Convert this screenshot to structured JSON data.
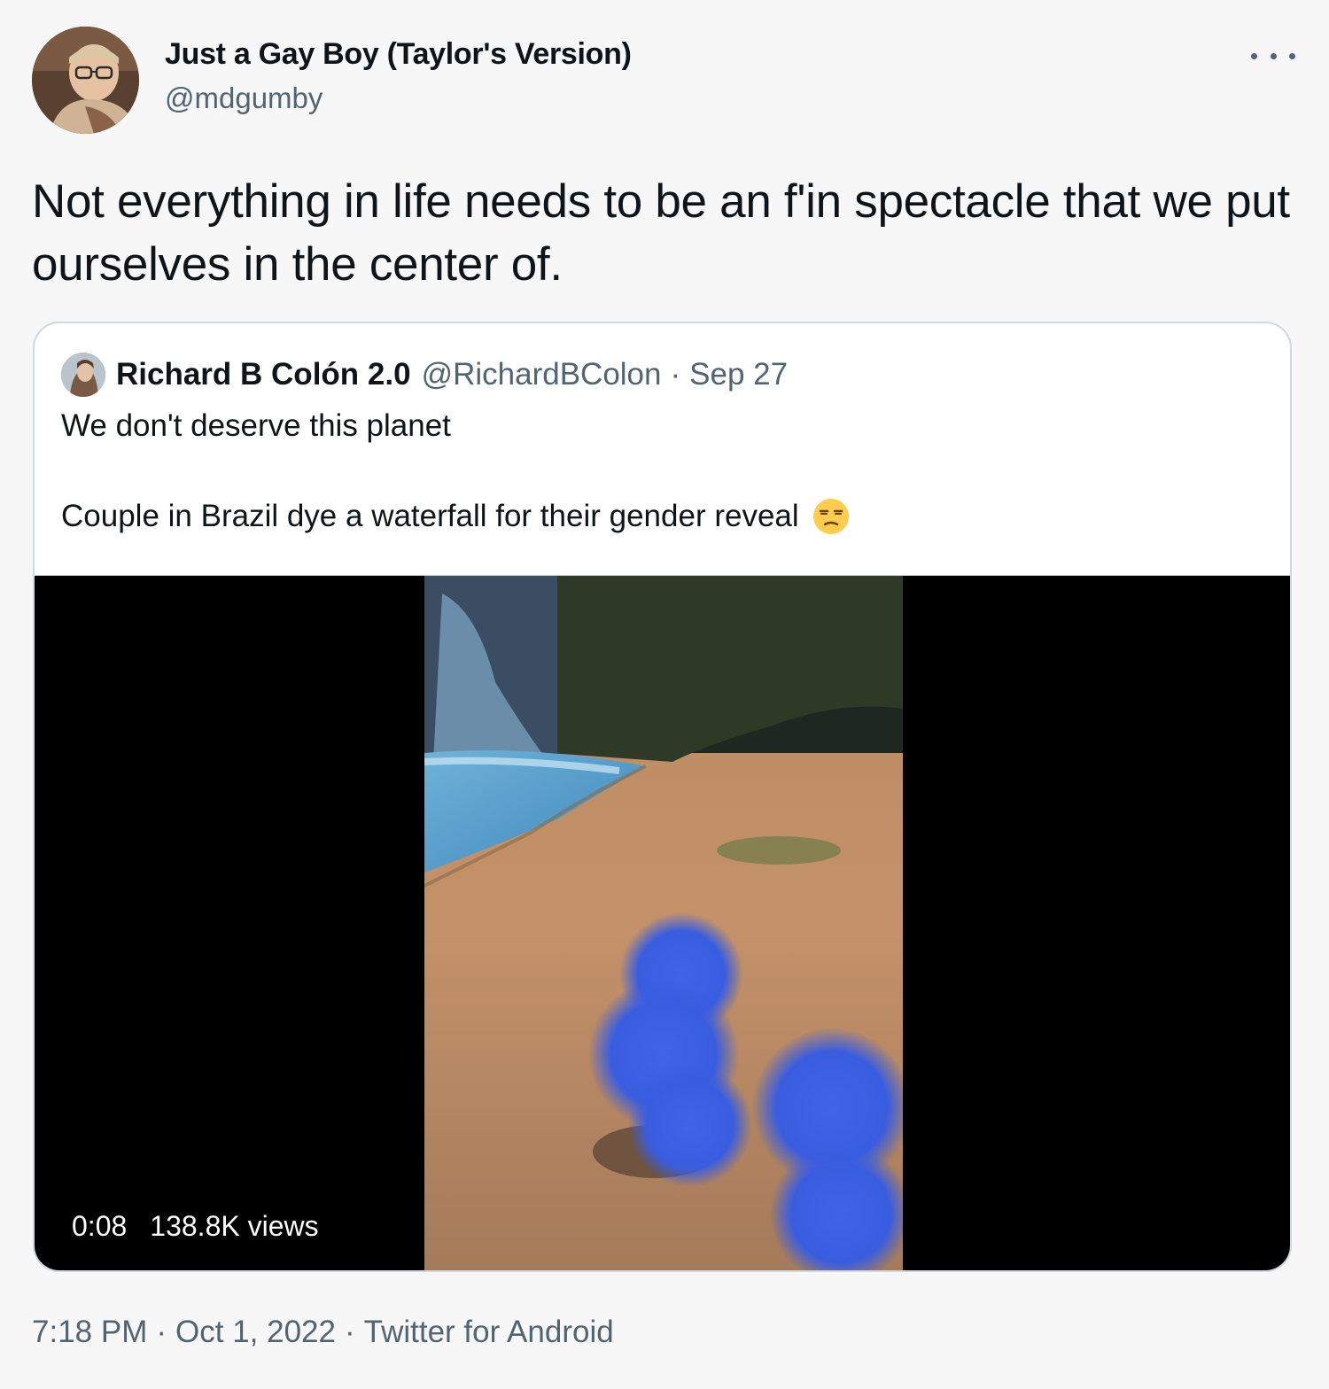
{
  "tweet": {
    "author": {
      "display_name": "Just a Gay Boy (Taylor's Version)",
      "handle": "@mdgumby"
    },
    "text": "Not everything in life needs to be an f'in spectacle that we put ourselves in the center of.",
    "timestamp": "7:18 PM",
    "date": "Oct 1, 2022",
    "source": "Twitter for Android",
    "separator": "·"
  },
  "quoted_tweet": {
    "author": {
      "display_name": "Richard B Colón 2.0",
      "handle": "@RichardBColon"
    },
    "separator": "·",
    "date": "Sep 27",
    "text_line1": "We don't deserve this planet",
    "text_line2": "Couple in Brazil dye a waterfall for their gender reveal",
    "emoji": "unamused-face-icon",
    "video": {
      "duration": "0:08",
      "views": "138.8K views"
    }
  },
  "icons": {
    "more": "more-horizontal-icon"
  }
}
